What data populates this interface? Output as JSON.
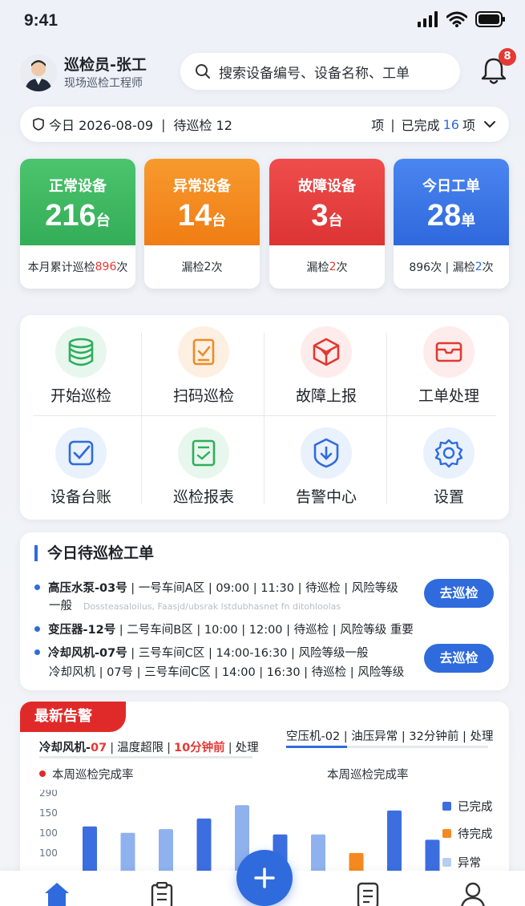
{
  "status_bar": {
    "time": "9:41"
  },
  "header": {
    "user_name": "巡检员-张工",
    "user_role": "现场巡检工程师",
    "search_placeholder": "搜索设备编号、设备名称、工单",
    "notification_count": "8"
  },
  "date_bar": {
    "date_text": "今日 2026-08-09",
    "pending_text": "待巡检 12",
    "pending_unit": "项",
    "done_prefix": "已完成",
    "done_count": "16",
    "done_unit": "项"
  },
  "stats": [
    {
      "title": "正常设备",
      "value": "216",
      "unit": "台",
      "bottom_prefix": "本月累计巡检 ",
      "bottom_highlight": "896",
      "bottom_suffix": "次",
      "color": "#3dbb62"
    },
    {
      "title": "异常设备",
      "value": "14",
      "unit": "台",
      "bottom_prefix": "漏检 ",
      "bottom_highlight": "2",
      "bottom_suffix": "次",
      "color": "#f5891f"
    },
    {
      "title": "故障设备",
      "value": "3",
      "unit": "台",
      "bottom_prefix": "漏检 ",
      "bottom_highlight": "2",
      "bottom_suffix": "次",
      "color": "#e84040"
    },
    {
      "title": "今日工单",
      "value": "28",
      "unit": "单",
      "bottom_prefix": "896次 | 漏检 ",
      "bottom_highlight": "2",
      "bottom_suffix": "次",
      "color": "#3c78e8"
    }
  ],
  "actions": [
    {
      "label": "开始巡检",
      "icon": "database-icon"
    },
    {
      "label": "扫码巡检",
      "icon": "scan-document-icon"
    },
    {
      "label": "故障上报",
      "icon": "box-report-icon"
    },
    {
      "label": "工单处理",
      "icon": "work-order-icon"
    },
    {
      "label": "设备台账",
      "icon": "checkbox-icon"
    },
    {
      "label": "巡检报表",
      "icon": "report-icon"
    },
    {
      "label": "告警中心",
      "icon": "shield-download-icon"
    },
    {
      "label": "设置",
      "icon": "gear-icon"
    }
  ],
  "tasks": {
    "title": "今日待巡检工单",
    "items": [
      {
        "name": "高压水泵-03号",
        "detail": " | 一号车间A区 | 09:00 | 11:30 | 待巡检 | 风险等级",
        "sub": "一般",
        "ghost": "Dossteasaloilus, Faasjd/ubsrak lstdubhasnet fn ditohloolas",
        "button": "去巡检"
      },
      {
        "name": "变压器-12号",
        "detail": " | 二号车间B区 | 10:00 | 12:00 | 待巡检 | 风险等级 重要"
      },
      {
        "name": "冷却风机-07号",
        "detail": " | 三号车间C区 | 14:00-16:30 | 风险等级一般",
        "sub": "冷却风机 | 07号 | 三号车间C区 | 14:00 | 16:30 | 待巡检 | 风险等级",
        "button": "去巡检"
      }
    ]
  },
  "alerts": {
    "title": "最新告警",
    "left": {
      "device": "冷却风机-",
      "device_code": "07",
      "type": "温度超限",
      "time": "10分钟前",
      "action": "处理"
    },
    "right": {
      "text": "空压机-02 | 油压异常 | 32分钟前 | 处理",
      "progress": 0.3
    },
    "chart_left_label": "本周巡检完成率",
    "chart_right_label": "本周巡检完成率"
  },
  "chart_data": {
    "type": "bar",
    "y_tick_labels": [
      "290",
      "150",
      "100",
      "100"
    ],
    "legend": [
      "已完成",
      "待完成",
      "异常"
    ],
    "colors": {
      "done": "#3c6ee0",
      "pending": "#f5891f",
      "abnormal": "#8fb2ee"
    },
    "bars": [
      {
        "series": "已完成",
        "value": 100
      },
      {
        "series": "异常",
        "value": 88
      },
      {
        "series": "异常",
        "value": 95
      },
      {
        "series": "已完成",
        "value": 115
      },
      {
        "series": "异常",
        "value": 140
      },
      {
        "series": "已完成",
        "value": 85
      },
      {
        "series": "异常",
        "value": 85
      },
      {
        "series": "待完成",
        "value": 50
      },
      {
        "series": "已完成",
        "value": 130
      },
      {
        "series": "已完成",
        "value": 75
      }
    ]
  }
}
